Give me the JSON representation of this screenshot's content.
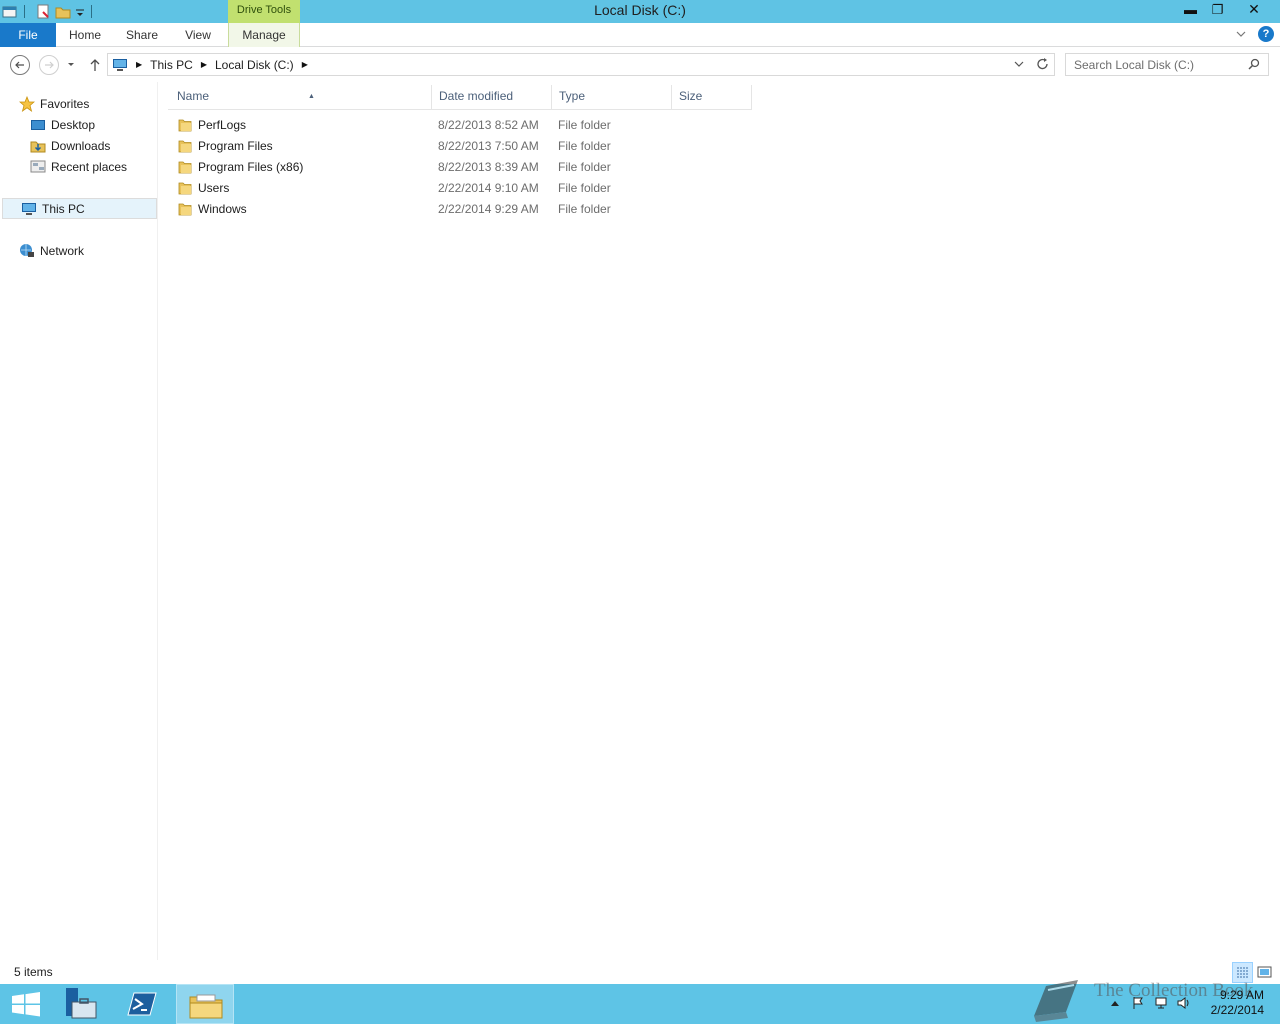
{
  "window": {
    "title": "Local Disk (C:)",
    "context_tab": "Drive Tools",
    "controls": {
      "minimize": "▬",
      "maximize": "❐",
      "close": "✕"
    }
  },
  "ribbon": {
    "tabs": [
      "File",
      "Home",
      "Share",
      "View",
      "Manage"
    ],
    "help": "?"
  },
  "address_bar": {
    "crumbs": [
      "This PC",
      "Local Disk (C:)"
    ],
    "search_placeholder": "Search Local Disk (C:)"
  },
  "nav_pane": {
    "favorites": "Favorites",
    "favorite_items": [
      "Desktop",
      "Downloads",
      "Recent places"
    ],
    "this_pc": "This PC",
    "network": "Network"
  },
  "columns": [
    "Name",
    "Date modified",
    "Type",
    "Size"
  ],
  "files": [
    {
      "name": "PerfLogs",
      "date": "8/22/2013 8:52 AM",
      "type": "File folder"
    },
    {
      "name": "Program Files",
      "date": "8/22/2013 7:50 AM",
      "type": "File folder"
    },
    {
      "name": "Program Files (x86)",
      "date": "8/22/2013 8:39 AM",
      "type": "File folder"
    },
    {
      "name": "Users",
      "date": "2/22/2014 9:10 AM",
      "type": "File folder"
    },
    {
      "name": "Windows",
      "date": "2/22/2014 9:29 AM",
      "type": "File folder"
    }
  ],
  "status": {
    "item_count": "5 items"
  },
  "taskbar": {
    "clock_time": "9:29 AM",
    "clock_date": "2/22/2014",
    "watermark": "The Collection Book"
  },
  "colors": {
    "title_bar": "#5fc3e4",
    "drive_tools": "#c1e06f",
    "file_tab": "#1979ca",
    "taskbar": "#5ec4e6",
    "folder": "#e8c25a"
  },
  "icons": {
    "quick_access": [
      "explorer-app-icon",
      "properties-icon",
      "new-folder-icon",
      "customize-qat-icon"
    ],
    "nav": [
      "star-icon",
      "desktop-icon",
      "downloads-icon",
      "recent-places-icon",
      "computer-icon",
      "network-icon"
    ],
    "taskbar": [
      "start-icon",
      "server-manager-icon",
      "powershell-icon",
      "file-explorer-icon"
    ]
  }
}
